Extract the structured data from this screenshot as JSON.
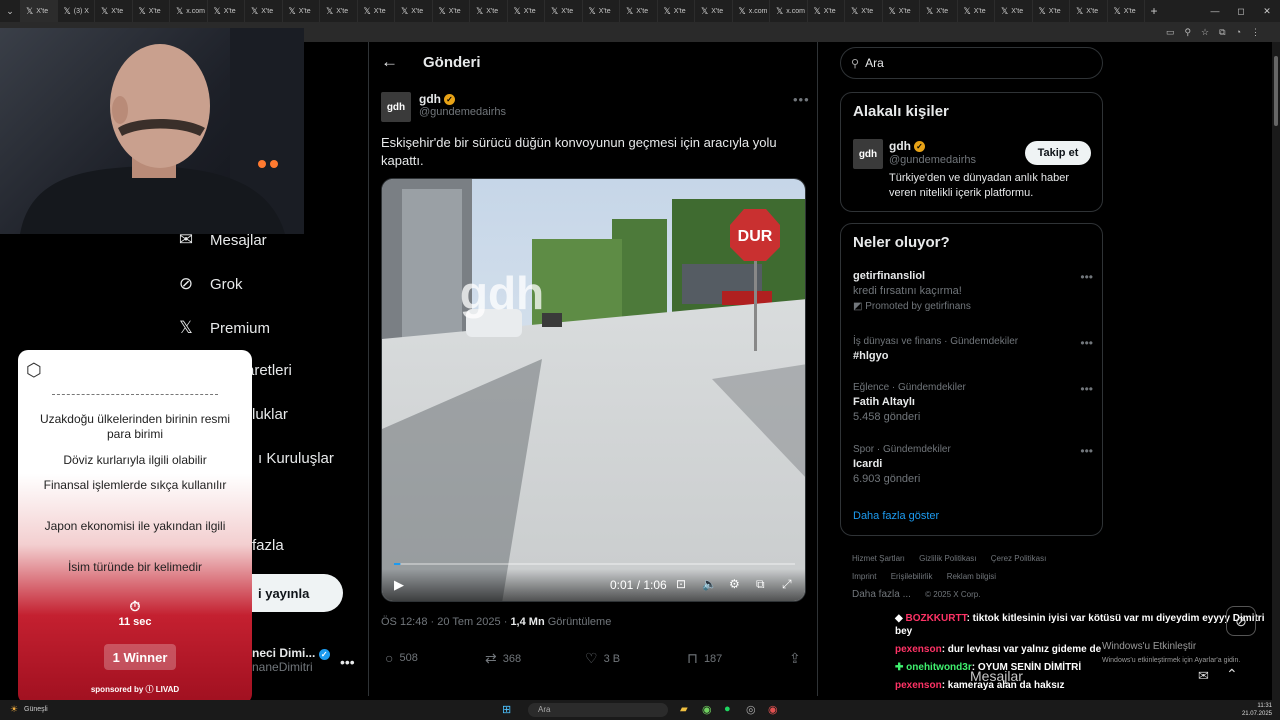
{
  "browser": {
    "tabs": [
      {
        "label": "X'te"
      },
      {
        "label": "(3) X"
      },
      {
        "label": "X'te"
      },
      {
        "label": "X'te"
      },
      {
        "label": "x.com"
      },
      {
        "label": "X'te"
      },
      {
        "label": "X'te"
      },
      {
        "label": "X'te"
      },
      {
        "label": "X'te"
      },
      {
        "label": "X'te"
      },
      {
        "label": "X'te"
      },
      {
        "label": "X'te"
      },
      {
        "label": "X'te"
      },
      {
        "label": "X'te"
      },
      {
        "label": "X'te"
      },
      {
        "label": "X'te"
      },
      {
        "label": "X'te"
      },
      {
        "label": "X'te"
      },
      {
        "label": "X'te"
      },
      {
        "label": "x.com"
      },
      {
        "label": "x.com"
      },
      {
        "label": "X'te"
      },
      {
        "label": "X'te"
      },
      {
        "label": "X'te"
      },
      {
        "label": "X'te"
      },
      {
        "label": "X'te"
      },
      {
        "label": "X'te"
      },
      {
        "label": "X'te"
      },
      {
        "label": "X'te"
      },
      {
        "label": "X'te"
      }
    ]
  },
  "nav": {
    "items": [
      {
        "label": "Mesajlar",
        "icon": "mail-icon"
      },
      {
        "label": "Grok",
        "icon": "grok-icon"
      },
      {
        "label": "Premium",
        "icon": "x-logo-icon"
      },
      {
        "label": "aretleri",
        "icon": "bookmark-icon"
      },
      {
        "label": "luklar",
        "icon": "community-icon"
      },
      {
        "label": "ı Kuruluşlar",
        "icon": "org-icon"
      },
      {
        "label": "fazla",
        "icon": "more-icon"
      }
    ],
    "post_button": "i yayınla",
    "account": {
      "name": "neci Dimi...",
      "handle": "naneDimitri"
    }
  },
  "post": {
    "header_title": "Gönderi",
    "author": {
      "avatar": "gdh",
      "name": "gdh",
      "handle": "@gundemedairhs"
    },
    "text": "Eskişehir'de bir sürücü düğün konvoyunun geçmesi için aracıyla yolu kapattı.",
    "video": {
      "watermark": "gdh",
      "sign": "DUR",
      "time": "0:01 / 1:06",
      "progress": 0.016
    },
    "meta": {
      "datetime": "ÖS 12:48 · 20 Tem 2025 · ",
      "views": "1,4 Mn",
      "views_label": " Görüntüleme"
    },
    "actions": {
      "replies": "508",
      "reposts": "368",
      "likes": "3 B",
      "bookmarks": "187"
    }
  },
  "search": {
    "placeholder": "Ara"
  },
  "related": {
    "title": "Alakalı kişiler",
    "person": {
      "avatar": "gdh",
      "name": "gdh",
      "handle": "@gundemedairhs",
      "bio": "Türkiye'den ve dünyadan anlık haber veren nitelikli içerik platformu.",
      "follow_label": "Takip et"
    }
  },
  "trends": {
    "title": "Neler oluyor?",
    "items": [
      {
        "context": "",
        "title": "getirfinansliol",
        "sub": "kredi fırsatını kaçırma!",
        "promo": "Promoted by getirfinans"
      },
      {
        "context": "İş dünyası ve finans · Gündemdekiler",
        "title": "#hlgyo",
        "sub": ""
      },
      {
        "context": "Eğlence · Gündemdekiler",
        "title": "Fatih Altaylı",
        "sub": "5.458 gönderi"
      },
      {
        "context": "Spor · Gündemdekiler",
        "title": "Icardi",
        "sub": "6.903 gönderi"
      }
    ],
    "show_more": "Daha fazla göster"
  },
  "footer": {
    "links": [
      "Hizmet Şartları",
      "Gizlilik Politikası",
      "Çerez Politikası",
      "Imprint",
      "Erişilebilirlik",
      "Reklam bilgisi"
    ],
    "more": "Daha fazla ...",
    "copyright": "© 2025 X Corp."
  },
  "quiz": {
    "clues": [
      "Uzakdoğu ülkelerinden birinin resmi para birimi",
      "Döviz kurlarıyla ilgili olabilir",
      "Finansal işlemlerde sıkça kullanılır",
      "Japon ekonomisi ile yakından ilgili",
      "İsim türünde bir kelimedir"
    ],
    "timer": "11 sec",
    "winner": "1 Winner",
    "sponsor": "sponsored by ⓛ LIVAD"
  },
  "chat": [
    {
      "user": "BOZKKURTT",
      "msg": ": tiktok kitlesinin iyisi var kötüsü var mı diyeydim eyyyy Dimitri bey",
      "cls": "u"
    },
    {
      "user": "pexenson",
      "msg": ": dur levhası var yalnız gideme de",
      "cls": "u"
    },
    {
      "user": "onehitwond3r",
      "msg": ": OYUM SENİN DİMİTRİ",
      "cls": "u2"
    },
    {
      "user": "pexenson",
      "msg": ": kameraya alan da haksız",
      "cls": "u"
    }
  ],
  "watermark": {
    "line1": "Windows'u Etkinleştir",
    "line2": "Windows'u etkinleştirmek için Ayarlar'a gidin."
  },
  "taskbar": {
    "weather": "Güneşli",
    "search": "Ara",
    "time": "11:31",
    "date": "21.07.2025"
  },
  "overlay_bottom": {
    "label": "Mesajlar"
  }
}
